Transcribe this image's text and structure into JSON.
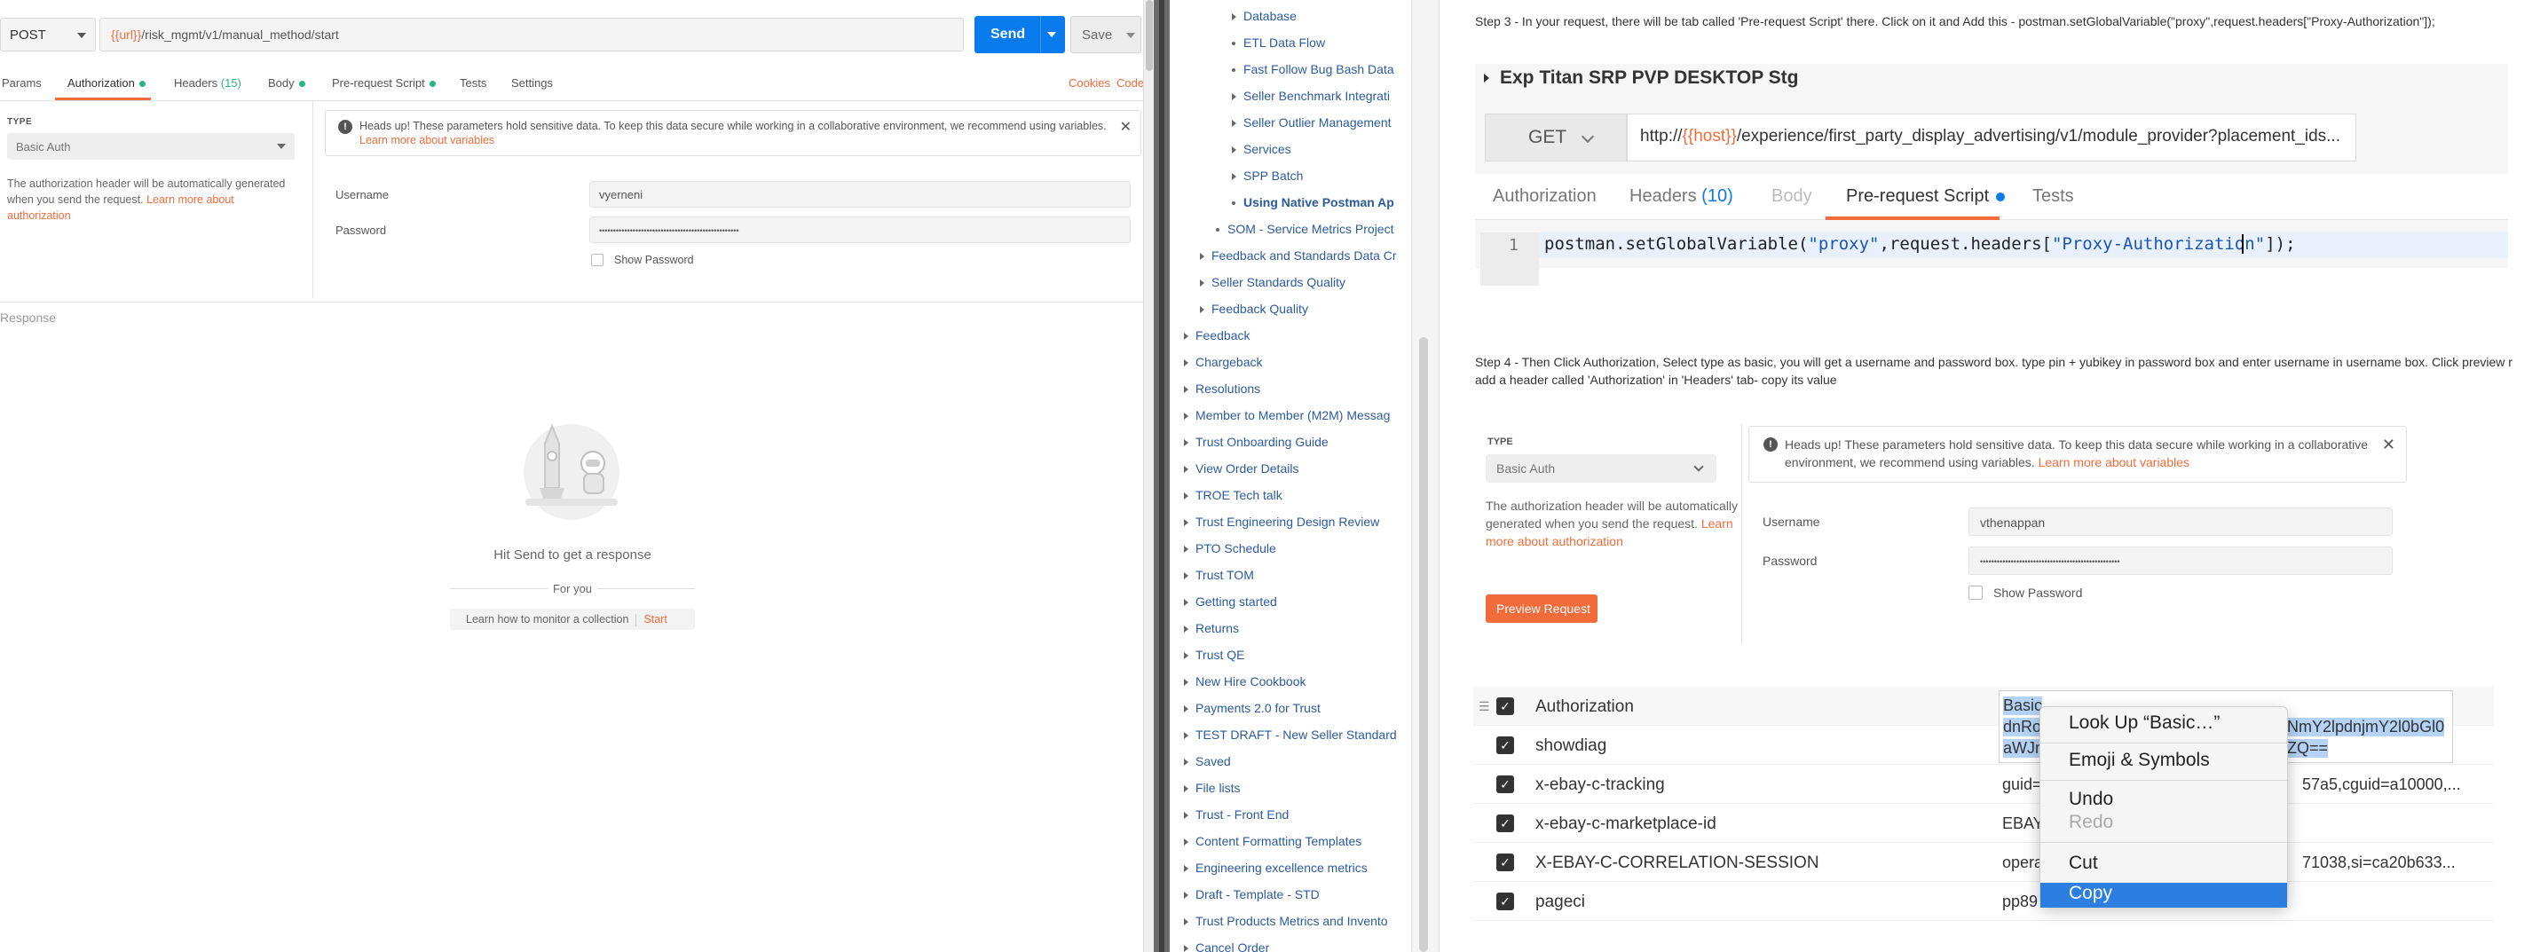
{
  "postman": {
    "method": "POST",
    "url_var": "{{url}}",
    "url_path": "/risk_mgmt/v1/manual_method/start",
    "send_label": "Send",
    "save_label": "Save",
    "tabs": {
      "params": "Params",
      "authorization": "Authorization",
      "headers": "Headers",
      "headers_count": "(15)",
      "body": "Body",
      "prerequest": "Pre-request Script",
      "tests": "Tests",
      "settings": "Settings"
    },
    "cookies": "Cookies",
    "code": "Code",
    "type_label": "TYPE",
    "type_value": "Basic Auth",
    "auth_desc": "The authorization header will be automatically generated when you send the request.",
    "auth_desc_link": "Learn more about authorization",
    "warning_text": "Heads up! These parameters hold sensitive data. To keep this data secure while working in a collaborative environment, we recommend using variables.",
    "warning_link": "Learn more about variables",
    "username_label": "Username",
    "username_value": "vyerneni",
    "password_label": "Password",
    "password_value": "••••••••••••••••••••••••••••••••••••••••••••••••••",
    "show_password": "Show Password",
    "response_label": "Response",
    "hit_send": "Hit Send to get a response",
    "for_you": "For you",
    "learn_monitor": "Learn how to monitor a collection",
    "start": "Start"
  },
  "tree": {
    "items": [
      {
        "label": "Database",
        "kind": "chev"
      },
      {
        "label": "ETL Data Flow",
        "kind": "bullet"
      },
      {
        "label": "Fast Follow Bug Bash Data",
        "kind": "bullet"
      },
      {
        "label": "Seller Benchmark Integrati",
        "kind": "chev"
      },
      {
        "label": "Seller Outlier Management",
        "kind": "chev"
      },
      {
        "label": "Services",
        "kind": "chev"
      },
      {
        "label": "SPP Batch",
        "kind": "chev"
      },
      {
        "label": "Using Native Postman Ap",
        "kind": "bullet"
      },
      {
        "label": "SOM - Service Metrics Project",
        "kind": "bullet"
      },
      {
        "label": "Feedback and Standards Data Cr",
        "kind": "chev"
      },
      {
        "label": "Seller Standards Quality",
        "kind": "chev"
      },
      {
        "label": "Feedback Quality",
        "kind": "chev"
      },
      {
        "label": "Feedback",
        "kind": "chev"
      },
      {
        "label": "Chargeback",
        "kind": "chev"
      },
      {
        "label": "Resolutions",
        "kind": "chev"
      },
      {
        "label": "Member to Member (M2M) Messag",
        "kind": "chev"
      },
      {
        "label": "Trust Onboarding Guide",
        "kind": "chev"
      },
      {
        "label": "View Order Details",
        "kind": "chev"
      },
      {
        "label": "TROE Tech talk",
        "kind": "chev"
      },
      {
        "label": "Trust Engineering Design Review",
        "kind": "chev"
      },
      {
        "label": "PTO Schedule",
        "kind": "chev"
      },
      {
        "label": "Trust TOM",
        "kind": "chev"
      },
      {
        "label": "Getting started",
        "kind": "chev"
      },
      {
        "label": "Returns",
        "kind": "chev"
      },
      {
        "label": "Trust QE",
        "kind": "chev"
      },
      {
        "label": "New Hire Cookbook",
        "kind": "chev"
      },
      {
        "label": "Payments 2.0 for Trust",
        "kind": "chev"
      },
      {
        "label": "TEST DRAFT - New Seller Standard",
        "kind": "chev"
      },
      {
        "label": "Saved",
        "kind": "chev"
      },
      {
        "label": "File lists",
        "kind": "chev"
      },
      {
        "label": "Trust - Front End",
        "kind": "chev"
      },
      {
        "label": "Content Formatting Templates",
        "kind": "chev"
      },
      {
        "label": "Engineering excellence metrics",
        "kind": "chev"
      },
      {
        "label": "Draft - Template - STD",
        "kind": "chev"
      },
      {
        "label": "Trust Products Metrics and Invento",
        "kind": "chev"
      },
      {
        "label": "Cancel Order",
        "kind": "chev"
      }
    ]
  },
  "doc": {
    "step3": "Step 3 - In your request, there will be tab called 'Pre-request Script' there. Click on it and Add this - postman.setGlobalVariable(\"proxy\",request.headers[\"Proxy-Authorization\"]);",
    "step4_line1": "Step 4 - Then Click Authorization, Select type as basic, you will get a username and password box. type pin + yubikey in password box and enter username in username box. Click preview r",
    "step4_line2": "add a header called 'Authorization' in 'Headers' tab- copy its value",
    "shot1": {
      "title": "Exp Titan SRP PVP DESKTOP Stg",
      "method": "GET",
      "url_prefix": "http://",
      "url_var": "{{host}}",
      "url_rest": "/experience/first_party_display_advertising/v1/module_provider?placement_ids...",
      "tabs": {
        "authorization": "Authorization",
        "headers": "Headers",
        "headers_count": "(10)",
        "body": "Body",
        "prerequest": "Pre-request Script",
        "tests": "Tests"
      },
      "line_no": "1",
      "code_a": "postman.setGlobalVariable(",
      "code_s1": "\"proxy\"",
      "code_b": ",request.headers[",
      "code_s2": "\"Proxy-Authorization\"",
      "code_c": "]);"
    },
    "shot2": {
      "type_label": "TYPE",
      "type_value": "Basic Auth",
      "desc": "The authorization header will be automatically generated when you send the request.",
      "desc_link": "Learn more about authorization",
      "warning_text": "Heads up! These parameters hold sensitive data. To keep this data secure while working in a collaborative environment, we recommend using variables.",
      "warning_link": "Learn more about variables",
      "username_label": "Username",
      "username_value": "vthenappan",
      "password_label": "Password",
      "password_value": "••••••••••••••••••••••••••••••••••••••••••••••••••",
      "show_password": "Show Password",
      "preview": "Preview Request"
    },
    "headers": [
      {
        "key": "Authorization",
        "value": ""
      },
      {
        "key": "showdiag",
        "value": ""
      },
      {
        "key": "x-ebay-c-tracking",
        "value": "guid=",
        "value_tail": "57a5,cguid=a10000,..."
      },
      {
        "key": "x-ebay-c-marketplace-id",
        "value": "EBAY"
      },
      {
        "key": "X-EBAY-C-CORRELATION-SESSION",
        "value": "opera",
        "value_tail": "71038,si=ca20b633..."
      },
      {
        "key": "pageci",
        "value": "pp89"
      }
    ],
    "auth_value": {
      "line1_sel": "Basic",
      "line2_a": "dnRo",
      "line2_b": "NmY2lpdnjmY2l0bGl0",
      "line3_a": "aWJm",
      "line3_b": "ZQ=="
    },
    "context_menu": {
      "lookup": "Look Up “Basic…”",
      "emoji": "Emoji & Symbols",
      "undo": "Undo",
      "redo": "Redo",
      "cut": "Cut",
      "copy": "Copy"
    }
  }
}
